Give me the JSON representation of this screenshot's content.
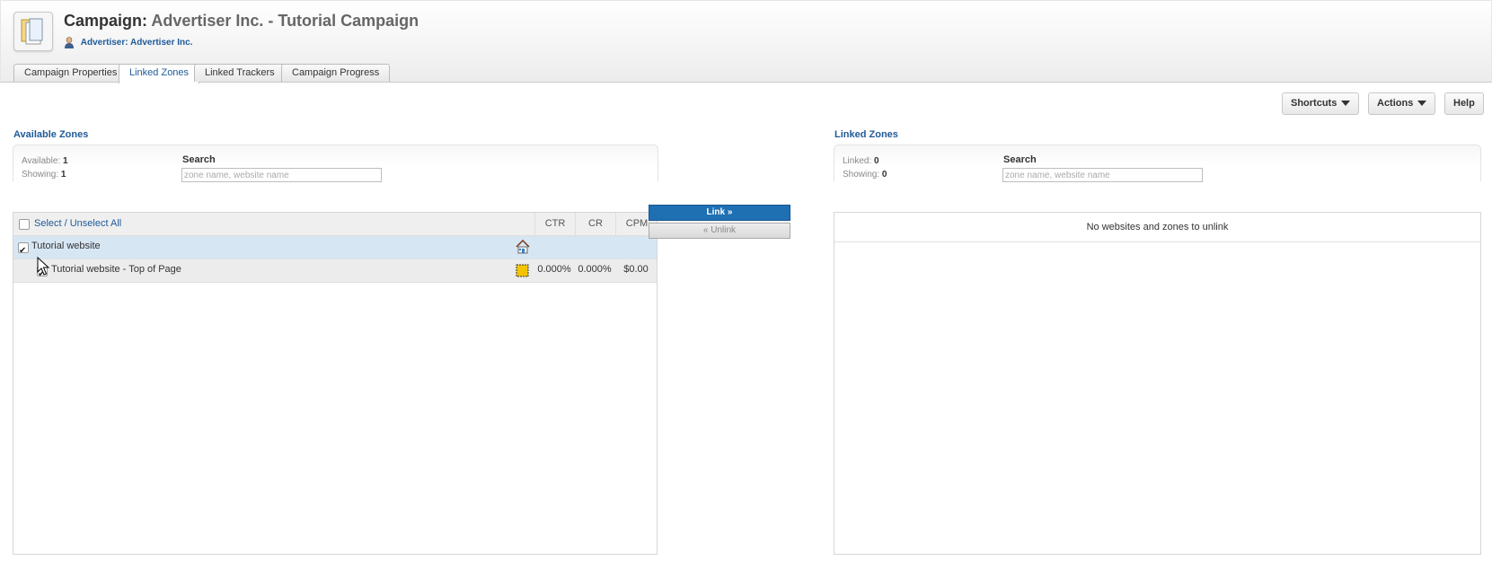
{
  "header": {
    "title_prefix": "Campaign:",
    "title_name": "Advertiser Inc. - Tutorial Campaign",
    "advertiser_link": "Advertiser: Advertiser Inc.",
    "icon": "campaign-folder-icon"
  },
  "tabs": [
    {
      "label": "Campaign Properties",
      "active": false
    },
    {
      "label": "Linked Zones",
      "active": true
    },
    {
      "label": "Linked Trackers",
      "active": false
    },
    {
      "label": "Campaign Progress",
      "active": false
    }
  ],
  "toolbar": {
    "shortcuts_label": "Shortcuts",
    "actions_label": "Actions",
    "help_label": "Help"
  },
  "available": {
    "title": "Available Zones",
    "available_label": "Available:",
    "available_count": "1",
    "showing_label": "Showing:",
    "showing_count": "1",
    "search_label": "Search",
    "search_placeholder": "zone name, website name",
    "select_all_label": "Select / Unselect All",
    "columns": {
      "ctr": "CTR",
      "cr": "CR",
      "cpm": "CPM"
    },
    "website_row": {
      "name": "Tutorial website",
      "checked": true,
      "icon": "website-house-icon"
    },
    "zone_row": {
      "name": "Tutorial website - Top of Page",
      "checked": true,
      "icon": "zone-banner-icon",
      "ctr": "0.000%",
      "cr": "0.000%",
      "cpm": "$0.00"
    }
  },
  "actions": {
    "link_label": "Link »",
    "unlink_label": "« Unlink"
  },
  "linked": {
    "title": "Linked Zones",
    "linked_label": "Linked:",
    "linked_count": "0",
    "showing_label": "Showing:",
    "showing_count": "0",
    "search_label": "Search",
    "search_placeholder": "zone name, website name",
    "empty_message": "No websites and zones to unlink"
  },
  "colors": {
    "accent": "#1f5a99",
    "link_button": "#1f6fb3",
    "selected_row": "#d7e6f3"
  }
}
